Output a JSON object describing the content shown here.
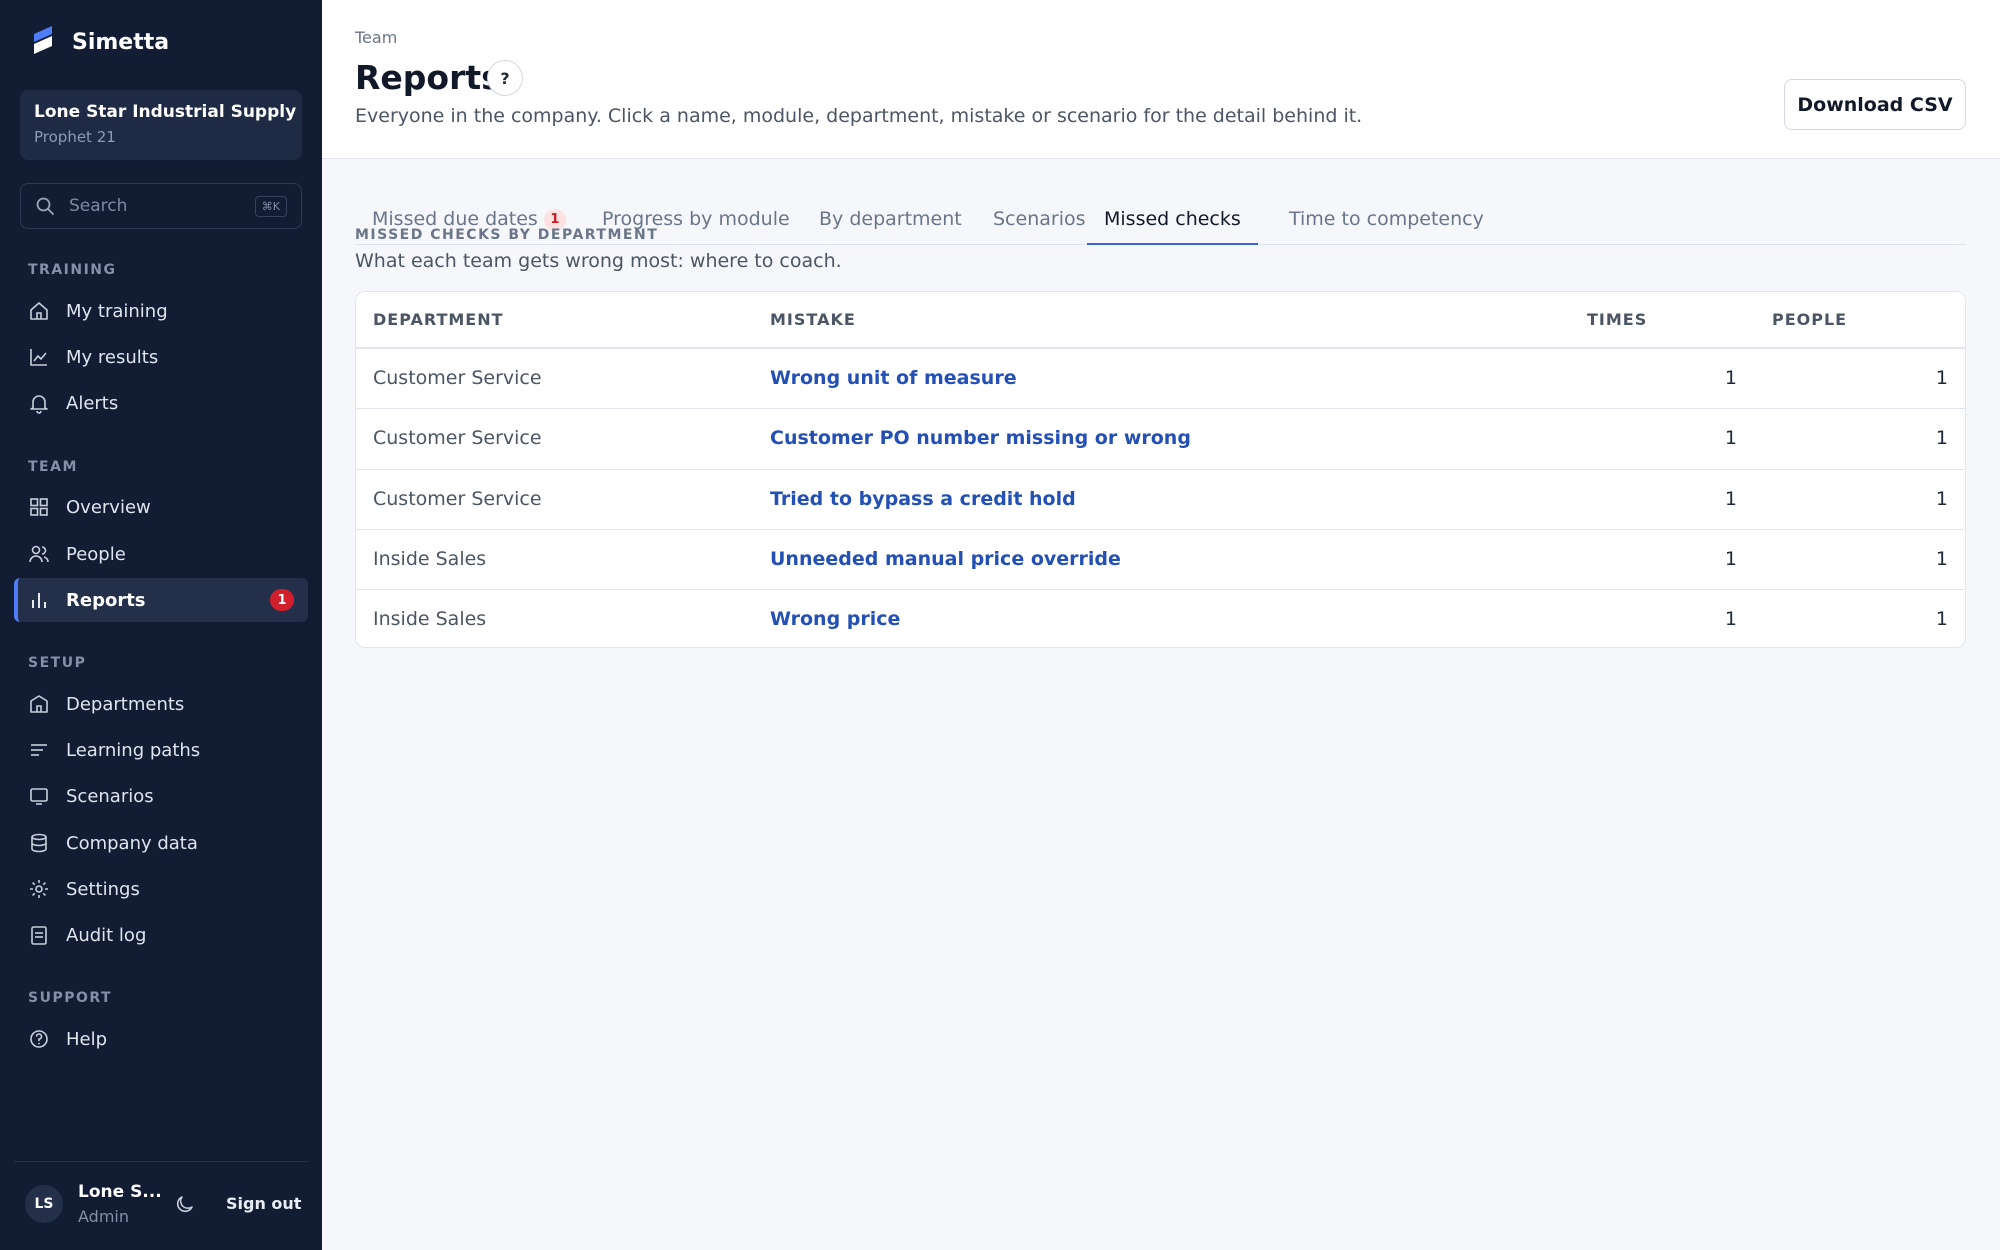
{
  "sidebar": {
    "brand": "Simetta",
    "org": {
      "name": "Lone Star Industrial Supply",
      "system": "Prophet 21"
    },
    "search": {
      "placeholder": "Search",
      "shortcut": "⌘K"
    },
    "sections": {
      "training": "TRAINING",
      "team": "TEAM",
      "setup": "SETUP",
      "support": "SUPPORT"
    },
    "items": {
      "my_training": "My training",
      "my_results": "My results",
      "alerts": "Alerts",
      "overview": "Overview",
      "people": "People",
      "reports": "Reports",
      "reports_badge": "1",
      "departments": "Departments",
      "learning_paths": "Learning paths",
      "scenarios": "Scenarios",
      "company_data": "Company data",
      "settings": "Settings",
      "audit_log": "Audit log",
      "help": "Help"
    },
    "user": {
      "initials": "LS",
      "name": "Lone S...",
      "role": "Admin",
      "sign_out": "Sign out"
    }
  },
  "header": {
    "breadcrumb": "Team",
    "title": "Reports",
    "help": "?",
    "description": "Everyone in the company. Click a name, module, department, mistake or scenario for the detail behind it.",
    "download": "Download CSV"
  },
  "tabs": {
    "missed_due_dates": "Missed due dates",
    "missed_due_dates_badge": "1",
    "progress_by_module": "Progress by module",
    "by_department": "By department",
    "scenarios": "Scenarios",
    "missed_checks": "Missed checks",
    "time_to_competency": "Time to competency",
    "active": "Missed checks"
  },
  "section": {
    "heading": "MISSED CHECKS BY DEPARTMENT",
    "subtitle": "What each team gets wrong most: where to coach."
  },
  "table": {
    "headers": {
      "department": "DEPARTMENT",
      "mistake": "MISTAKE",
      "times": "TIMES",
      "people": "PEOPLE"
    },
    "rows": [
      {
        "department": "Customer Service",
        "mistake": "Wrong unit of measure",
        "times": "1",
        "people": "1"
      },
      {
        "department": "Customer Service",
        "mistake": "Customer PO number missing or wrong",
        "times": "1",
        "people": "1"
      },
      {
        "department": "Customer Service",
        "mistake": "Tried to bypass a credit hold",
        "times": "1",
        "people": "1"
      },
      {
        "department": "Inside Sales",
        "mistake": "Unneeded manual price override",
        "times": "1",
        "people": "1"
      },
      {
        "department": "Inside Sales",
        "mistake": "Wrong price",
        "times": "1",
        "people": "1"
      }
    ]
  },
  "colors": {
    "sidebar_bg": "#121c32",
    "accent": "#3b63d8",
    "link": "#2450b5",
    "badge": "#d21f2c"
  }
}
